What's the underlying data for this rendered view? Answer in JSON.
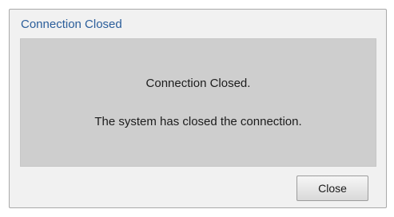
{
  "dialog": {
    "title": "Connection Closed",
    "message_primary": "Connection Closed.",
    "message_secondary": "The system has closed the connection.",
    "close_label": "Close"
  },
  "colors": {
    "title_text": "#2a5d9a",
    "dialog_bg": "#f1f1f1",
    "content_bg": "#cecece",
    "border": "#a9a9a9"
  }
}
